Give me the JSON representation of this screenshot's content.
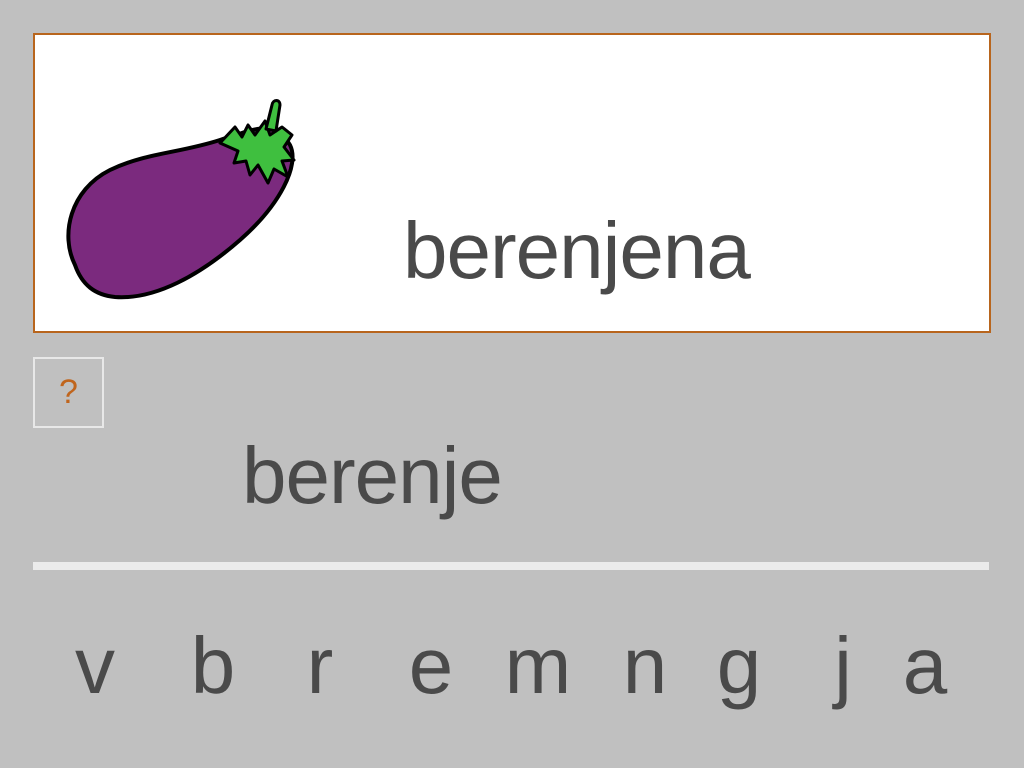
{
  "card": {
    "word": "berenjena",
    "image_icon": "eggplant-icon",
    "border_color": "#b8651d"
  },
  "hint": {
    "label": "?"
  },
  "answer": {
    "text": "berenje"
  },
  "letters": [
    "v",
    "b",
    "r",
    "e",
    "m",
    "n",
    "g",
    "j",
    "a"
  ],
  "colors": {
    "background": "#c0c0c0",
    "text": "#4a4a4a",
    "hint": "#c0651d",
    "eggplant": "#7b2a7e",
    "stem": "#3fbf3f"
  }
}
